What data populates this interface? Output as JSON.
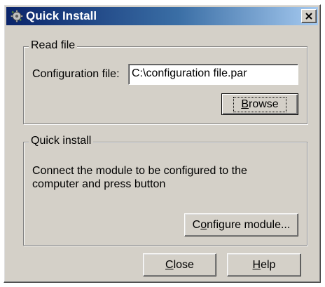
{
  "window": {
    "title": "Quick Install",
    "close_glyph": "×"
  },
  "read_file": {
    "legend": "Read file",
    "config_label": "Configuration file:",
    "config_value": "C:\\configuration file.par",
    "browse": {
      "pre": "",
      "mnemonic": "B",
      "post": "rowse"
    }
  },
  "quick_install": {
    "legend": "Quick install",
    "description": "Connect the module to be configured to the computer and press button",
    "configure": {
      "pre": "C",
      "mnemonic": "o",
      "post": "nfigure module..."
    }
  },
  "footer": {
    "close": {
      "pre": "",
      "mnemonic": "C",
      "post": "lose"
    },
    "help": {
      "pre": "",
      "mnemonic": "H",
      "post": "elp"
    }
  },
  "icons": {
    "app": "gear-icon",
    "close": "close-icon"
  }
}
